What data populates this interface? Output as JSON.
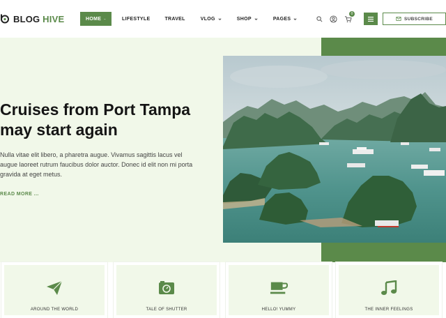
{
  "site": {
    "logo_main": "BLOG",
    "logo_accent": "HIVE"
  },
  "nav": {
    "items": [
      {
        "label": "HOME",
        "dropdown": true,
        "active": true
      },
      {
        "label": "LIFESTYLE",
        "dropdown": false,
        "active": false
      },
      {
        "label": "TRAVEL",
        "dropdown": false,
        "active": false
      },
      {
        "label": "VLOG",
        "dropdown": true,
        "active": false
      },
      {
        "label": "SHOP",
        "dropdown": true,
        "active": false
      },
      {
        "label": "PAGES",
        "dropdown": true,
        "active": false
      }
    ]
  },
  "header_tools": {
    "cart_count": "0",
    "subscribe_label": "SUBSCRIBE",
    "icons": [
      "search-icon",
      "user-icon",
      "cart-icon",
      "menu-icon",
      "mail-icon"
    ]
  },
  "hero": {
    "title": "Cruises from Port Tampa may start again",
    "description": "Nulla vitae elit libero, a pharetra augue. Vivamus sagittis lacus vel augue laoreet rutrum faucibus dolor auctor. Donec id elit non mi porta gravida at eget metus.",
    "read_more": "READ MORE ..."
  },
  "categories": [
    {
      "label": "AROUND THE WORLD",
      "icon": "paper-plane-icon"
    },
    {
      "label": "TALE OF SHUTTER",
      "icon": "camera-icon"
    },
    {
      "label": "HELLO! YUMMY",
      "icon": "coffee-cup-icon"
    },
    {
      "label": "THE INNER FEELINGS",
      "icon": "music-note-icon"
    }
  ],
  "colors": {
    "accent": "#5b8a4a",
    "hero_bg": "#f1f8e9",
    "text": "#151515"
  }
}
